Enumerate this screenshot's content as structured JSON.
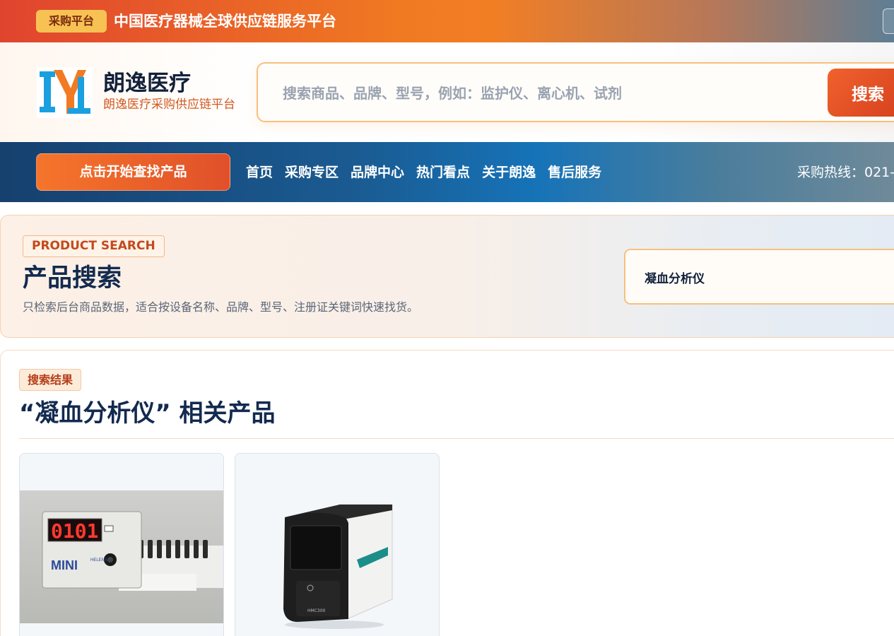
{
  "topbar": {
    "badge": "采购平台",
    "slogan": "中国医疗器械全球供应链服务平台"
  },
  "header": {
    "brand_name": "朗逸医疗",
    "brand_sub": "朗逸医疗采购供应链平台",
    "search_placeholder": "搜索商品、品牌、型号，例如：监护仪、离心机、试剂",
    "search_button": "搜索"
  },
  "nav": {
    "find_button": "点击开始查找产品",
    "links": [
      "首页",
      "采购专区",
      "品牌中心",
      "热门看点",
      "关于朗逸",
      "售后服务"
    ],
    "hotline": "采购热线：021-"
  },
  "product_search": {
    "tag": "PRODUCT SEARCH",
    "title": "产品搜索",
    "description": "只检索后台商品数据，适合按设备名称、品牌、型号、注册证关键词快速找货。",
    "query": "凝血分析仪"
  },
  "results": {
    "tag": "搜索结果",
    "title": "“凝血分析仪” 相关产品",
    "cards": [
      {
        "display_reading": "0101",
        "brand_text": "MINI",
        "maker_text": "HELENA"
      },
      {
        "device_label": "HMC300"
      }
    ]
  },
  "colors": {
    "accent_orange": "#f07a22",
    "nav_blue": "#1a5b92",
    "title_navy": "#132a4f"
  }
}
